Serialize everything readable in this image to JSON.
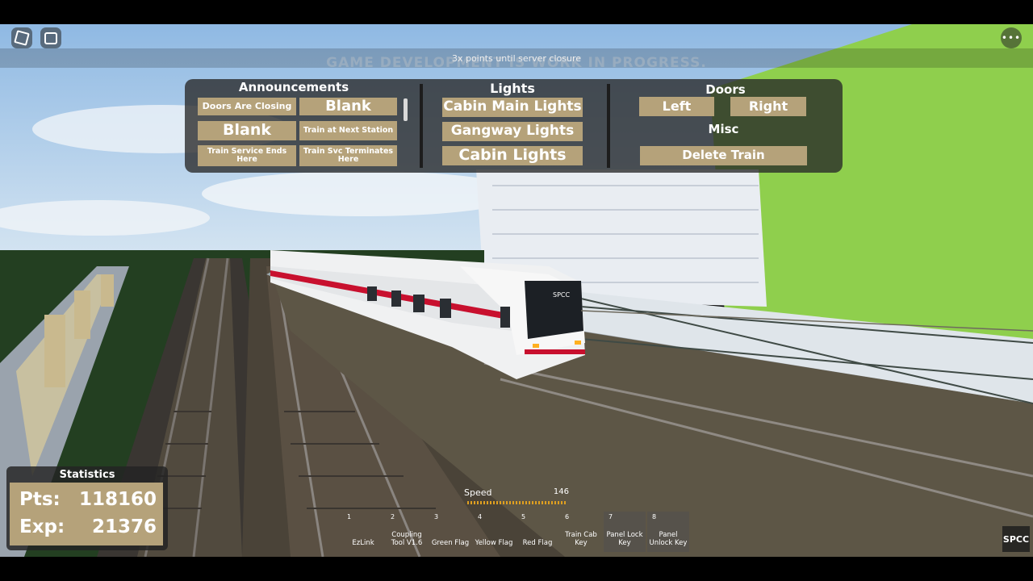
{
  "server_banner": "3x points until server closure",
  "background_notice": "GAME DEVELOPMENT IS WORK IN PROGRESS.",
  "announcements": {
    "title": "Announcements",
    "buttons": [
      "Doors Are Closing",
      "Blank",
      "Blank",
      "Train at Next Station",
      "Train Service Ends Here",
      "Train Svc Terminates Here"
    ]
  },
  "lights": {
    "title": "Lights",
    "buttons": [
      "Cabin Main Lights",
      "Gangway Lights",
      "Cabin Lights"
    ]
  },
  "doors": {
    "title": "Doors",
    "left": "Left",
    "right": "Right"
  },
  "misc": {
    "title": "Misc",
    "delete": "Delete Train"
  },
  "statistics": {
    "title": "Statistics",
    "pts_label": "Pts:",
    "pts_value": "118160",
    "exp_label": "Exp:",
    "exp_value": "21376"
  },
  "speed": {
    "label": "Speed",
    "value": "146"
  },
  "hotbar": [
    {
      "num": "1",
      "label": "EzLink"
    },
    {
      "num": "2",
      "label": "Coupling Tool V1.6"
    },
    {
      "num": "3",
      "label": "Green Flag"
    },
    {
      "num": "4",
      "label": "Yellow Flag"
    },
    {
      "num": "5",
      "label": "Red Flag"
    },
    {
      "num": "6",
      "label": "Train Cab Key"
    },
    {
      "num": "7",
      "label": "Panel Lock Key"
    },
    {
      "num": "8",
      "label": "Panel Unlock Key"
    }
  ],
  "train_destination": "SPCC",
  "logo": "SPCC",
  "colors": {
    "button": "#b5a27a",
    "panel": "#282828",
    "train_stripe": "#c8102e"
  }
}
